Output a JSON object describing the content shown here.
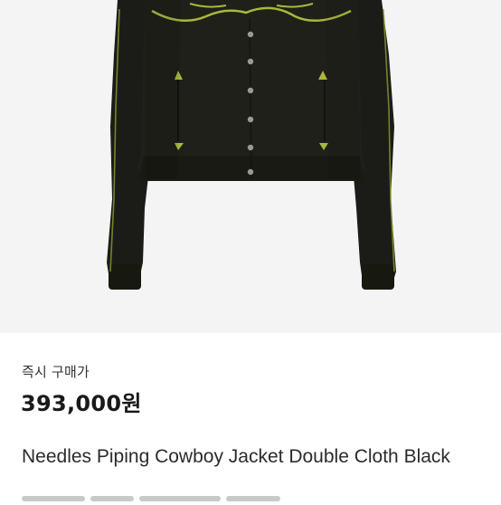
{
  "product": {
    "image_alt_icon": "jacket-photo",
    "purchase_type": "즉시 구매가",
    "price": "393,000원",
    "title": "Needles Piping Cowboy Jacket Double Cloth Black"
  },
  "colors": {
    "jacket": "#1c1d18",
    "piping": "#a9b83c",
    "background": "#f4f4f4"
  }
}
